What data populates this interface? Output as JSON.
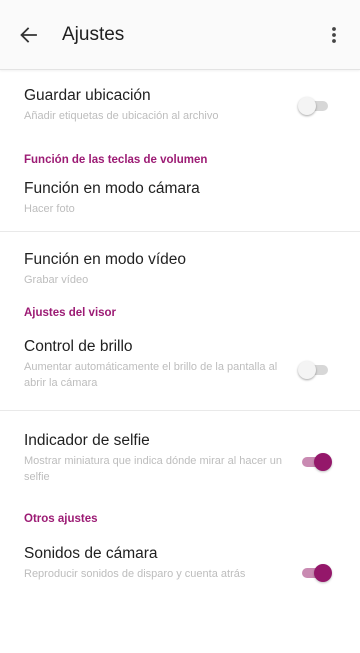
{
  "header": {
    "title": "Ajustes"
  },
  "colors": {
    "accent": "#94176a",
    "category": "#9c1b74"
  },
  "items": {
    "guardar": {
      "title": "Guardar ubicación",
      "subtitle": "Añadir etiquetas de ubicación al archivo",
      "checked": false
    },
    "cat_volumen": "Función de las teclas de volumen",
    "modo_camara": {
      "title": "Función en modo cámara",
      "subtitle": "Hacer foto"
    },
    "modo_video": {
      "title": "Función en modo vídeo",
      "subtitle": "Grabar vídeo"
    },
    "cat_visor": "Ajustes del visor",
    "brillo": {
      "title": "Control de brillo",
      "subtitle": "Aumentar automáticamente el brillo de la pantalla al abrir la cámara",
      "checked": false
    },
    "selfie": {
      "title": "Indicador de selfie",
      "subtitle": "Mostrar miniatura que indica dónde mirar al hacer un selfie",
      "checked": true
    },
    "cat_otros": "Otros ajustes",
    "sonidos": {
      "title": "Sonidos de cámara",
      "subtitle": "Reproducir sonidos de disparo y cuenta atrás",
      "checked": true
    }
  }
}
